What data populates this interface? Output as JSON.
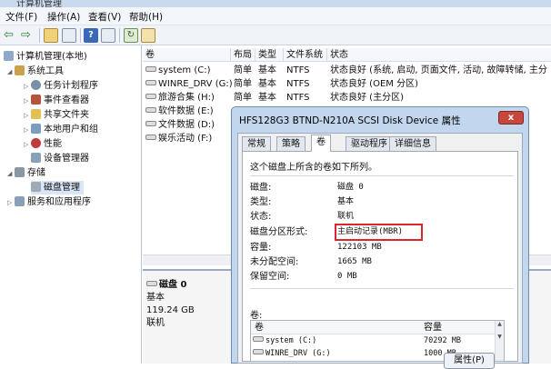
{
  "window": {
    "title": "计算机管理"
  },
  "menu": [
    "文件(F)",
    "操作(A)",
    "查看(V)",
    "帮助(H)"
  ],
  "toolbar": {
    "icons": [
      "back-icon",
      "forward-icon",
      "up-folder-icon",
      "show-tree-icon",
      "help-icon",
      "properties-icon",
      "refresh-icon",
      "export-icon"
    ]
  },
  "tree": {
    "root": "计算机管理(本地)",
    "system_tools": "系统工具",
    "task_scheduler": "任务计划程序",
    "event_viewer": "事件查看器",
    "shared_folders": "共享文件夹",
    "local_users": "本地用户和组",
    "performance": "性能",
    "device_manager": "设备管理器",
    "storage": "存储",
    "disk_management": "磁盘管理",
    "services": "服务和应用程序"
  },
  "volumes": {
    "columns": [
      "卷",
      "布局",
      "类型",
      "文件系统",
      "状态"
    ],
    "rows": [
      {
        "name": "system (C:)",
        "layout": "简单",
        "type": "基本",
        "fs": "NTFS",
        "status": "状态良好 (系统, 启动, 页面文件, 活动, 故障转储, 主分"
      },
      {
        "name": "WINRE_DRV (G:)",
        "layout": "简单",
        "type": "基本",
        "fs": "NTFS",
        "status": "状态良好 (OEM 分区)"
      },
      {
        "name": "旅游合集 (H:)",
        "layout": "简单",
        "type": "基本",
        "fs": "NTFS",
        "status": "状态良好 (主分区)"
      },
      {
        "name": "软件数据 (E:)",
        "layout": "",
        "type": "",
        "fs": "",
        "status": ""
      },
      {
        "name": "文件数据 (D:)",
        "layout": "",
        "type": "",
        "fs": "",
        "status": ""
      },
      {
        "name": "娱乐活动 (F:)",
        "layout": "",
        "type": "",
        "fs": "",
        "status": ""
      }
    ]
  },
  "disk": {
    "name": "磁盘 0",
    "type": "基本",
    "size": "119.24 GB",
    "state": "联机"
  },
  "dialog": {
    "title": "HFS128G3 BTND-N210A SCSI Disk Device 属性",
    "close": "x",
    "tabs": [
      "常规",
      "策略",
      "卷",
      "驱动程序",
      "详细信息"
    ],
    "active_tab": "卷",
    "description": "这个磁盘上所含的卷如下所列。",
    "props": [
      {
        "k": "磁盘:",
        "v": "磁盘 0"
      },
      {
        "k": "类型:",
        "v": "基本"
      },
      {
        "k": "状态:",
        "v": "联机"
      },
      {
        "k": "磁盘分区形式:",
        "v": "主启动记录(MBR)"
      },
      {
        "k": "容量:",
        "v": "122103 MB"
      },
      {
        "k": "未分配空间:",
        "v": "1665 MB"
      },
      {
        "k": "保留空间:",
        "v": "0 MB"
      }
    ],
    "volumes_label": "卷:",
    "list_columns": [
      "卷",
      "容量"
    ],
    "list_rows": [
      {
        "name": "system (C:)",
        "cap": "70292 MB"
      },
      {
        "name": "WINRE_DRV (G:)",
        "cap": "1000 MB"
      }
    ],
    "properties_button": "属性(P)"
  },
  "colors": {
    "highlight": "#d8282e",
    "dialog_frame": "#c2d6ee"
  }
}
